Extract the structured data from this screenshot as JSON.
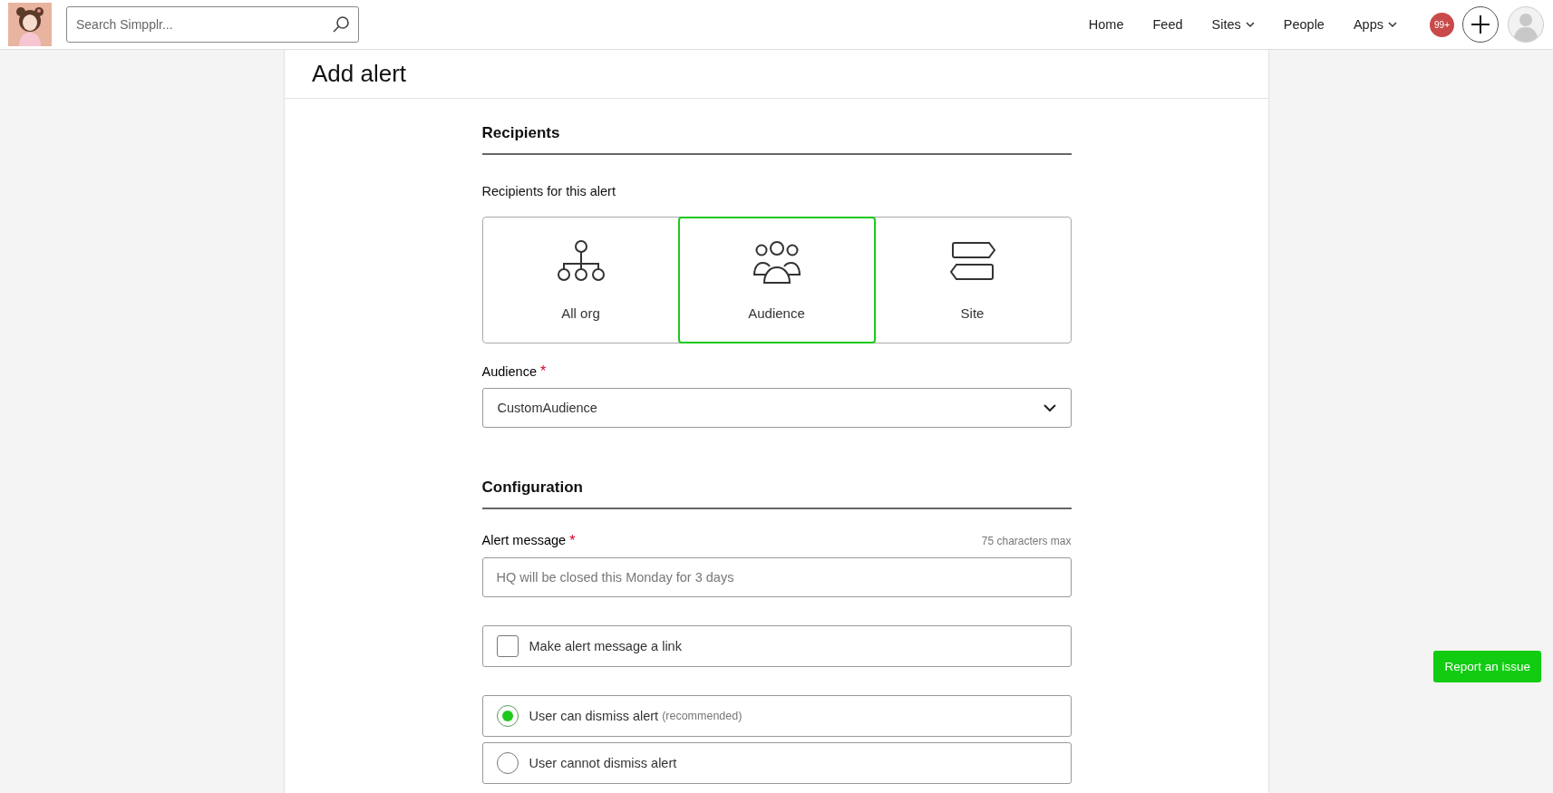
{
  "header": {
    "search": {
      "placeholder": "Search Simpplr..."
    },
    "nav": [
      {
        "label": "Home",
        "dropdown": false
      },
      {
        "label": "Feed",
        "dropdown": false
      },
      {
        "label": "Sites",
        "dropdown": true
      },
      {
        "label": "People",
        "dropdown": false
      },
      {
        "label": "Apps",
        "dropdown": true
      }
    ],
    "notifications": "99+"
  },
  "page": {
    "title": "Add alert"
  },
  "recipients": {
    "heading": "Recipients",
    "label": "Recipients for this alert",
    "options": [
      {
        "kind": "org",
        "label": "All org",
        "selected": false
      },
      {
        "kind": "audience",
        "label": "Audience",
        "selected": true
      },
      {
        "kind": "site",
        "label": "Site",
        "selected": false
      }
    ],
    "audience": {
      "label": "Audience",
      "required_mark": "*",
      "value": "CustomAudience"
    }
  },
  "configuration": {
    "heading": "Configuration",
    "message": {
      "label": "Alert message",
      "required_mark": "*",
      "hint": "75 characters max",
      "placeholder": "HQ will be closed this Monday for 3 days"
    },
    "link": {
      "label": "Make alert message a link",
      "checked": false
    },
    "dismiss": [
      {
        "label": "User can dismiss alert",
        "note": "(recommended)",
        "selected": true
      },
      {
        "label": "User cannot dismiss alert",
        "selected": false
      }
    ]
  },
  "report_button": "Report an issue"
}
